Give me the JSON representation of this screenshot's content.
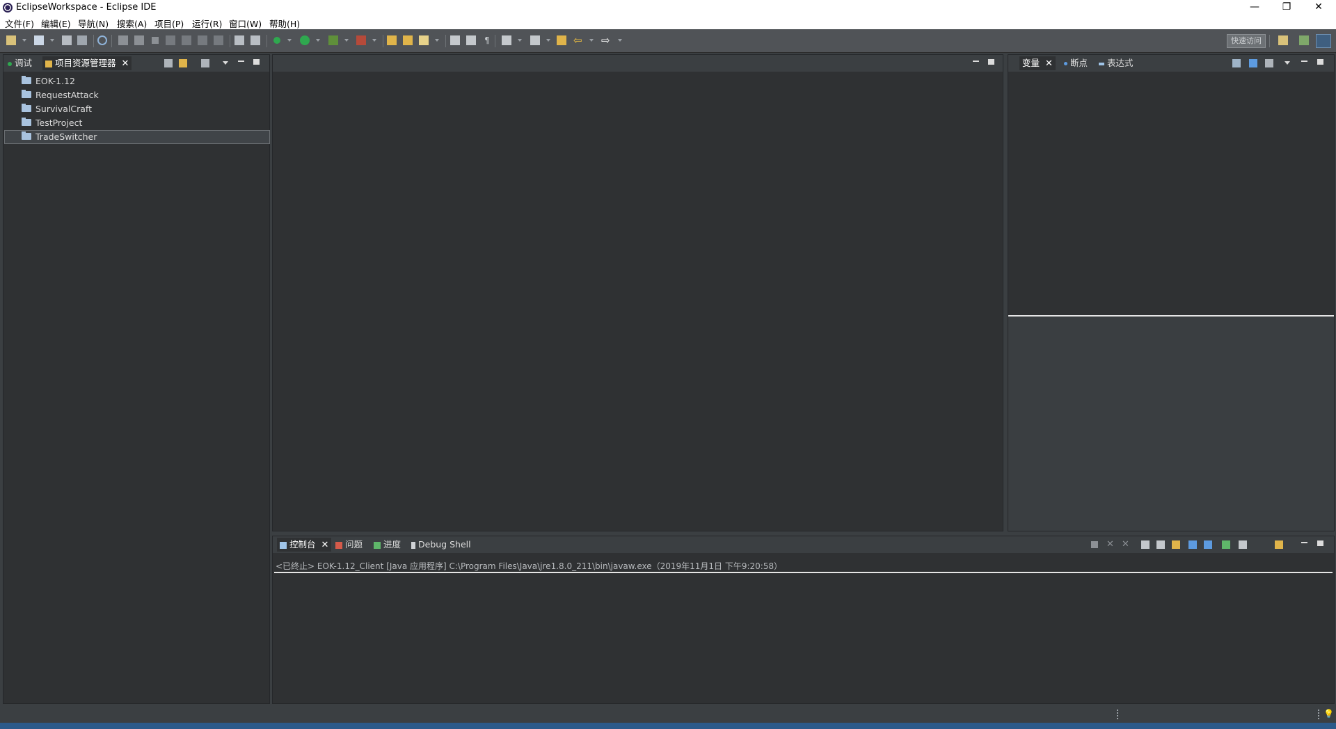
{
  "window": {
    "title": "EclipseWorkspace - Eclipse IDE",
    "controls": {
      "minimize": "—",
      "restore": "❐",
      "close": "✕"
    }
  },
  "menu": [
    "文件(F)",
    "编辑(E)",
    "导航(N)",
    "搜索(A)",
    "项目(P)",
    "运行(R)",
    "窗口(W)",
    "帮助(H)"
  ],
  "toolbar": {
    "quick_access": "快速访问"
  },
  "left_panel": {
    "tabs": [
      {
        "label": "调试",
        "icon": "debug-bug-icon",
        "active": false
      },
      {
        "label": "项目资源管理器",
        "icon": "project-explorer-icon",
        "active": true
      }
    ],
    "projects": [
      "EOK-1.12",
      "RequestAttack",
      "SurvivalCraft",
      "TestProject",
      "TradeSwitcher"
    ],
    "selected_project": "TradeSwitcher"
  },
  "right_panel": {
    "tabs": [
      {
        "label": "变量",
        "icon": "variables-icon",
        "active": true
      },
      {
        "label": "断点",
        "icon": "breakpoints-icon",
        "active": false
      },
      {
        "label": "表达式",
        "icon": "expressions-icon",
        "active": false
      }
    ]
  },
  "bottom_panel": {
    "tabs": [
      {
        "label": "控制台",
        "icon": "console-icon",
        "active": true
      },
      {
        "label": "问题",
        "icon": "problems-icon",
        "active": false
      },
      {
        "label": "进度",
        "icon": "progress-icon",
        "active": false
      },
      {
        "label": "Debug Shell",
        "icon": "debug-shell-icon",
        "active": false
      }
    ],
    "console_text": "<已终止> EOK-1.12_Client [Java 应用程序] C:\\Program Files\\Java\\jre1.8.0_211\\bin\\javaw.exe（2019年11月1日 下午9:20:58）"
  },
  "colors": {
    "background": "#3b3f42",
    "panel": "#2f3133",
    "folder_icon": "#a9c3df",
    "run_green": "#2fa84f"
  }
}
